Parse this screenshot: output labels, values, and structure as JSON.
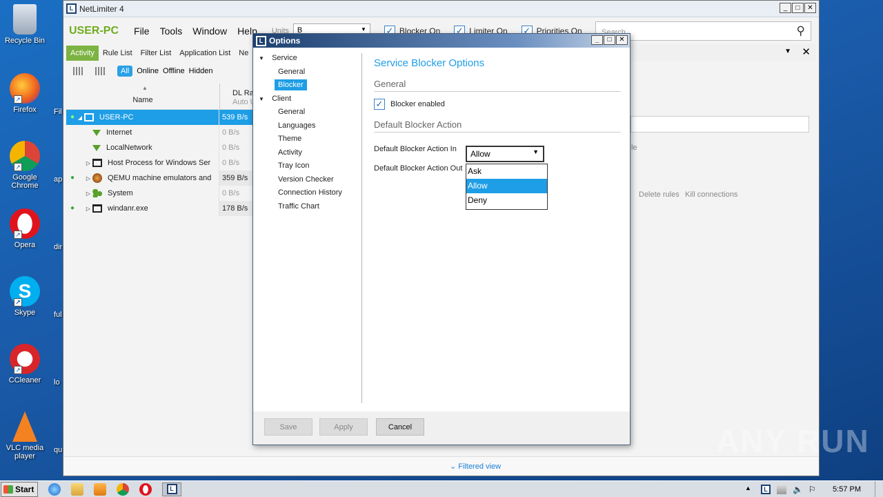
{
  "desktop": {
    "icons": [
      {
        "label": "Recycle Bin"
      },
      {
        "label": "Firefox"
      },
      {
        "label": "Google Chrome"
      },
      {
        "label": "Opera"
      },
      {
        "label": "Skype"
      },
      {
        "label": "CCleaner"
      },
      {
        "label": "VLC media player"
      }
    ],
    "cut_labels": [
      "Fil",
      "ap",
      "dir",
      "ful",
      "lo",
      "qui"
    ]
  },
  "main_window": {
    "title": "NetLimiter 4",
    "logo": "L",
    "machine_name": "USER-PC",
    "menu": [
      "File",
      "Tools",
      "Window",
      "Help"
    ],
    "units_label": "Units",
    "units_value": "B",
    "checks": {
      "blocker": {
        "label": "Blocker On",
        "checked": true
      },
      "limiter": {
        "label": "Limiter On",
        "checked": true
      },
      "priorities": {
        "label": "Priorities On",
        "checked": true
      }
    },
    "search_placeholder": "Search",
    "tabs": [
      "Activity",
      "Rule List",
      "Filter List",
      "Application List",
      "Ne"
    ],
    "filter": {
      "all": "All",
      "online": "Online",
      "offline": "Offline",
      "hidden": "Hidden"
    },
    "columns": {
      "name": "Name",
      "rate": "DL Ra",
      "rate_sub": "Auto U"
    },
    "rows": [
      {
        "name": "USER-PC",
        "rate": "539 B/s"
      },
      {
        "name": "Internet",
        "rate": "0 B/s"
      },
      {
        "name": "LocalNetwork",
        "rate": "0 B/s"
      },
      {
        "name": "Host Process for Windows Ser",
        "rate": "0 B/s"
      },
      {
        "name": "QEMU machine emulators and",
        "rate": "359 B/s"
      },
      {
        "name": "System",
        "rate": "0 B/s"
      },
      {
        "name": "windanr.exe",
        "rate": "178 B/s"
      }
    ],
    "right_panel": {
      "hint_tail": "le",
      "delete_rules": "Delete rules",
      "kill_connections": "Kill connections"
    },
    "filtered_view": "Filtered view"
  },
  "options_dialog": {
    "title": "Options",
    "tree": {
      "service": "Service",
      "service_items": [
        "General",
        "Blocker"
      ],
      "client": "Client",
      "client_items": [
        "General",
        "Languages",
        "Theme",
        "Activity",
        "Tray Icon",
        "Version Checker",
        "Connection History",
        "Traffic Chart"
      ]
    },
    "heading": "Service Blocker Options",
    "section_general": "General",
    "blocker_enabled": "Blocker enabled",
    "section_default": "Default Blocker Action",
    "action_in_label": "Default Blocker Action In",
    "action_in_value": "Allow",
    "action_out_label": "Default Blocker Action Out",
    "dropdown_options": [
      "Ask",
      "Allow",
      "Deny"
    ],
    "buttons": {
      "save": "Save",
      "apply": "Apply",
      "cancel": "Cancel"
    }
  },
  "taskbar": {
    "start": "Start",
    "clock": "5:57 PM"
  },
  "watermark": "ANY RUN"
}
